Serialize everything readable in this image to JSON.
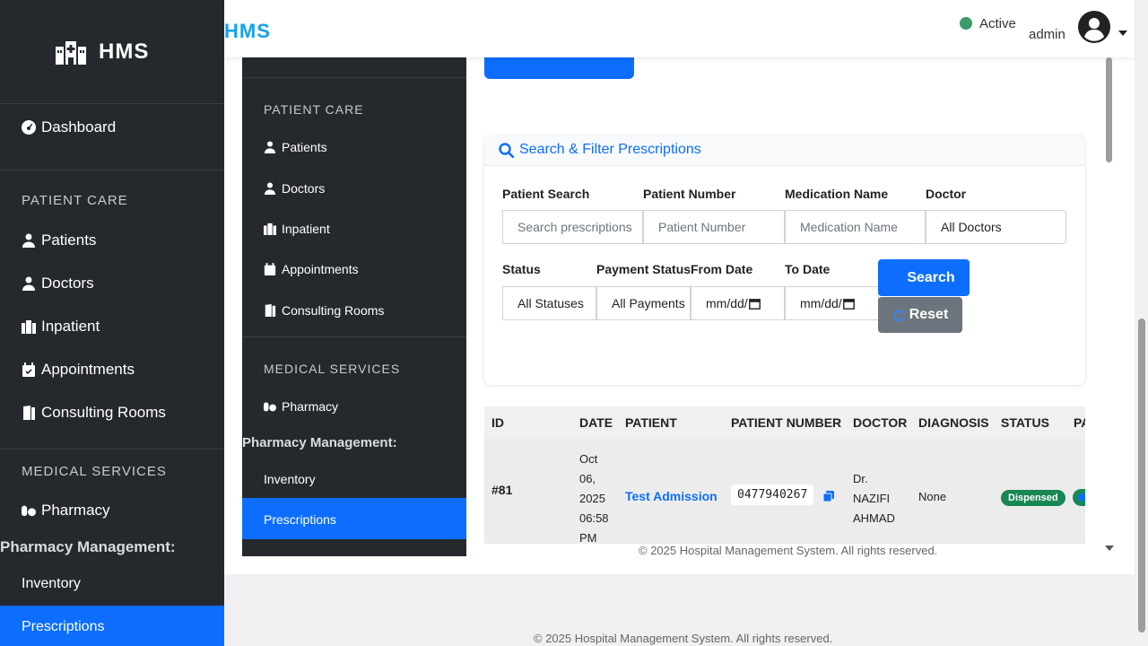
{
  "sidebar": {
    "brand": "HMS",
    "dashboard": "Dashboard",
    "section_patient_care": "PATIENT CARE",
    "patients": "Patients",
    "doctors": "Doctors",
    "inpatient": "Inpatient",
    "appointments": "Appointments",
    "consulting_rooms": "Consulting Rooms",
    "section_medical_services": "MEDICAL SERVICES",
    "pharmacy": "Pharmacy",
    "pharmacy_management": "Pharmacy Management:",
    "inventory": "Inventory",
    "prescriptions": "Prescriptions"
  },
  "topbar": {
    "logo": "HMS",
    "status": "Active",
    "user": "admin"
  },
  "filter": {
    "title": "Search & Filter Prescriptions",
    "patient_search_label": "Patient Search",
    "patient_search_placeholder": "Search prescriptions",
    "patient_number_label": "Patient Number",
    "patient_number_placeholder": "Patient Number",
    "medication_label": "Medication Name",
    "medication_placeholder": "Medication Name",
    "doctor_label": "Doctor",
    "doctor_value": "All Doctors",
    "status_label": "Status",
    "status_value": "All Statuses",
    "payment_label": "Payment Status",
    "payment_value": "All Payments",
    "from_label": "From Date",
    "from_value": "mm/dd/",
    "to_label": "To Date",
    "to_value": "mm/dd/",
    "search_button": "Search",
    "reset_button": "Reset"
  },
  "table": {
    "columns": [
      "ID",
      "DATE",
      "PATIENT",
      "PATIENT NUMBER",
      "DOCTOR",
      "DIAGNOSIS",
      "STATUS",
      "PA"
    ],
    "rows": [
      {
        "id": "#81",
        "date_lines": [
          "Oct",
          "06,",
          "2025",
          "06:58",
          "PM"
        ],
        "patient": "Test Admission",
        "patient_number": "0477940267",
        "doctor_lines": [
          "Dr.",
          "NAZIFI",
          "AHMAD"
        ],
        "diagnosis": "None",
        "status": "Dispensed"
      }
    ]
  },
  "footer": "© 2025 Hospital Management System. All rights reserved.",
  "colors": {
    "primary": "#0d6efd",
    "sidebar": "#25292e",
    "success": "#198754",
    "secondary": "#6c757d",
    "logo": "#12a3e8"
  }
}
